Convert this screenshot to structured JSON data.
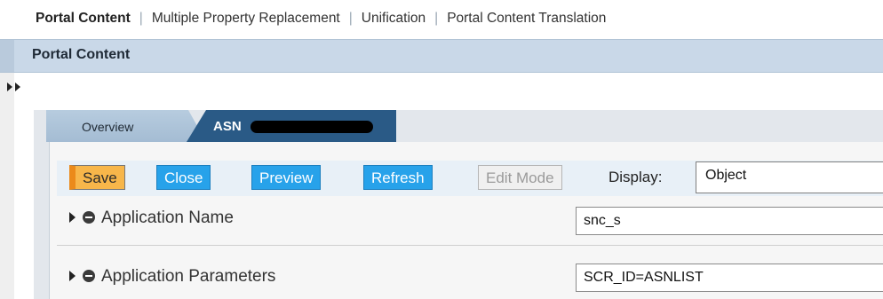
{
  "topnav": {
    "items": [
      {
        "label": "Portal Content"
      },
      {
        "label": "Multiple Property Replacement"
      },
      {
        "label": "Unification"
      },
      {
        "label": "Portal Content Translation"
      }
    ],
    "separator": "|"
  },
  "header": {
    "title": "Portal Content"
  },
  "tabs": [
    {
      "label": "Overview"
    },
    {
      "label": "ASN"
    }
  ],
  "toolbar": {
    "save_label": "Save",
    "close_label": "Close",
    "preview_label": "Preview",
    "refresh_label": "Refresh",
    "edit_mode_label": "Edit Mode",
    "display_label": "Display:",
    "display_value": "Object"
  },
  "rows": [
    {
      "label": "Application Name",
      "value": "snc_s"
    },
    {
      "label": "Application Parameters",
      "value": "SCR_ID=ASNLIST"
    }
  ],
  "colors": {
    "header_bar": "#c9d8e8",
    "active_tab": "#2a5a86",
    "button_blue": "#27a2ea",
    "save_orange": "#f7b64a"
  }
}
